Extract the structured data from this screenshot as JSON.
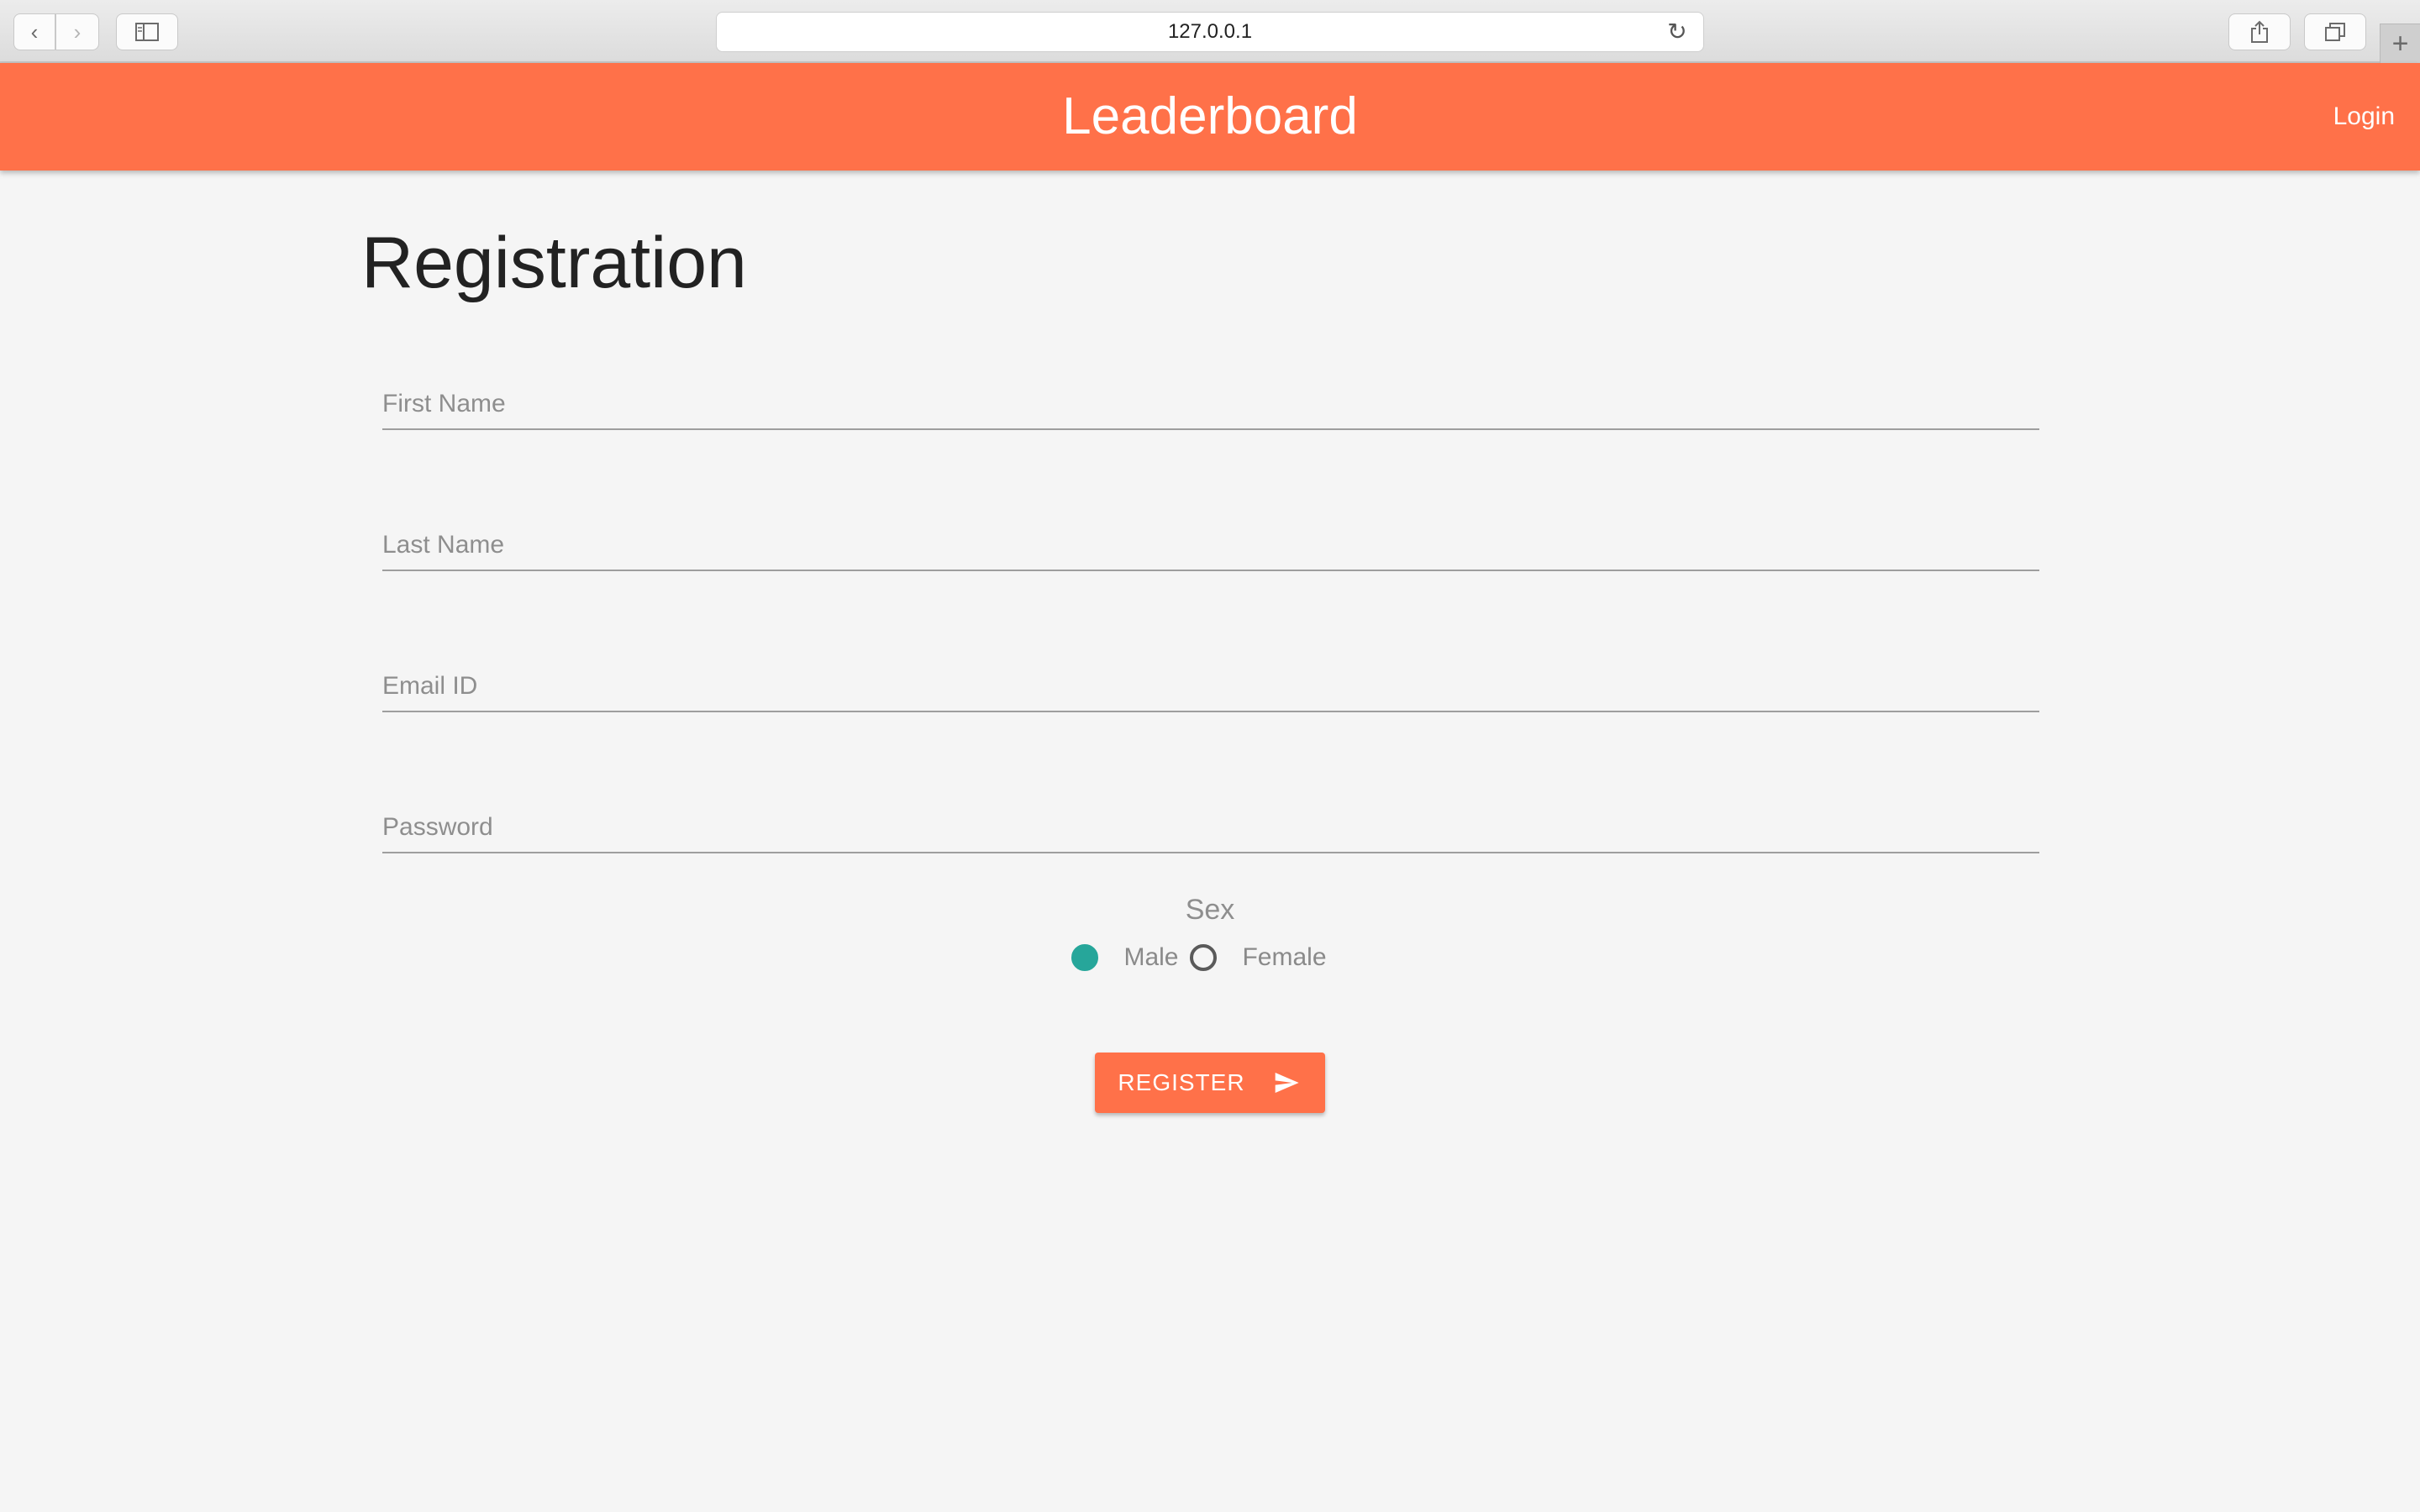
{
  "browser": {
    "url": "127.0.0.1",
    "back_icon": "‹",
    "forward_icon": "›",
    "new_tab_icon": "+",
    "reload_icon": "↻"
  },
  "header": {
    "title": "Leaderboard",
    "login_label": "Login",
    "color": "#ff7149"
  },
  "form": {
    "title": "Registration",
    "first_name_placeholder": "First Name",
    "last_name_placeholder": "Last Name",
    "email_placeholder": "Email ID",
    "password_placeholder": "Password",
    "sex_label": "Sex",
    "options": [
      {
        "label": "Male",
        "checked": true
      },
      {
        "label": "Female",
        "checked": false
      }
    ],
    "submit_label": "REGISTER",
    "radio_checked_color": "#26a69a"
  }
}
